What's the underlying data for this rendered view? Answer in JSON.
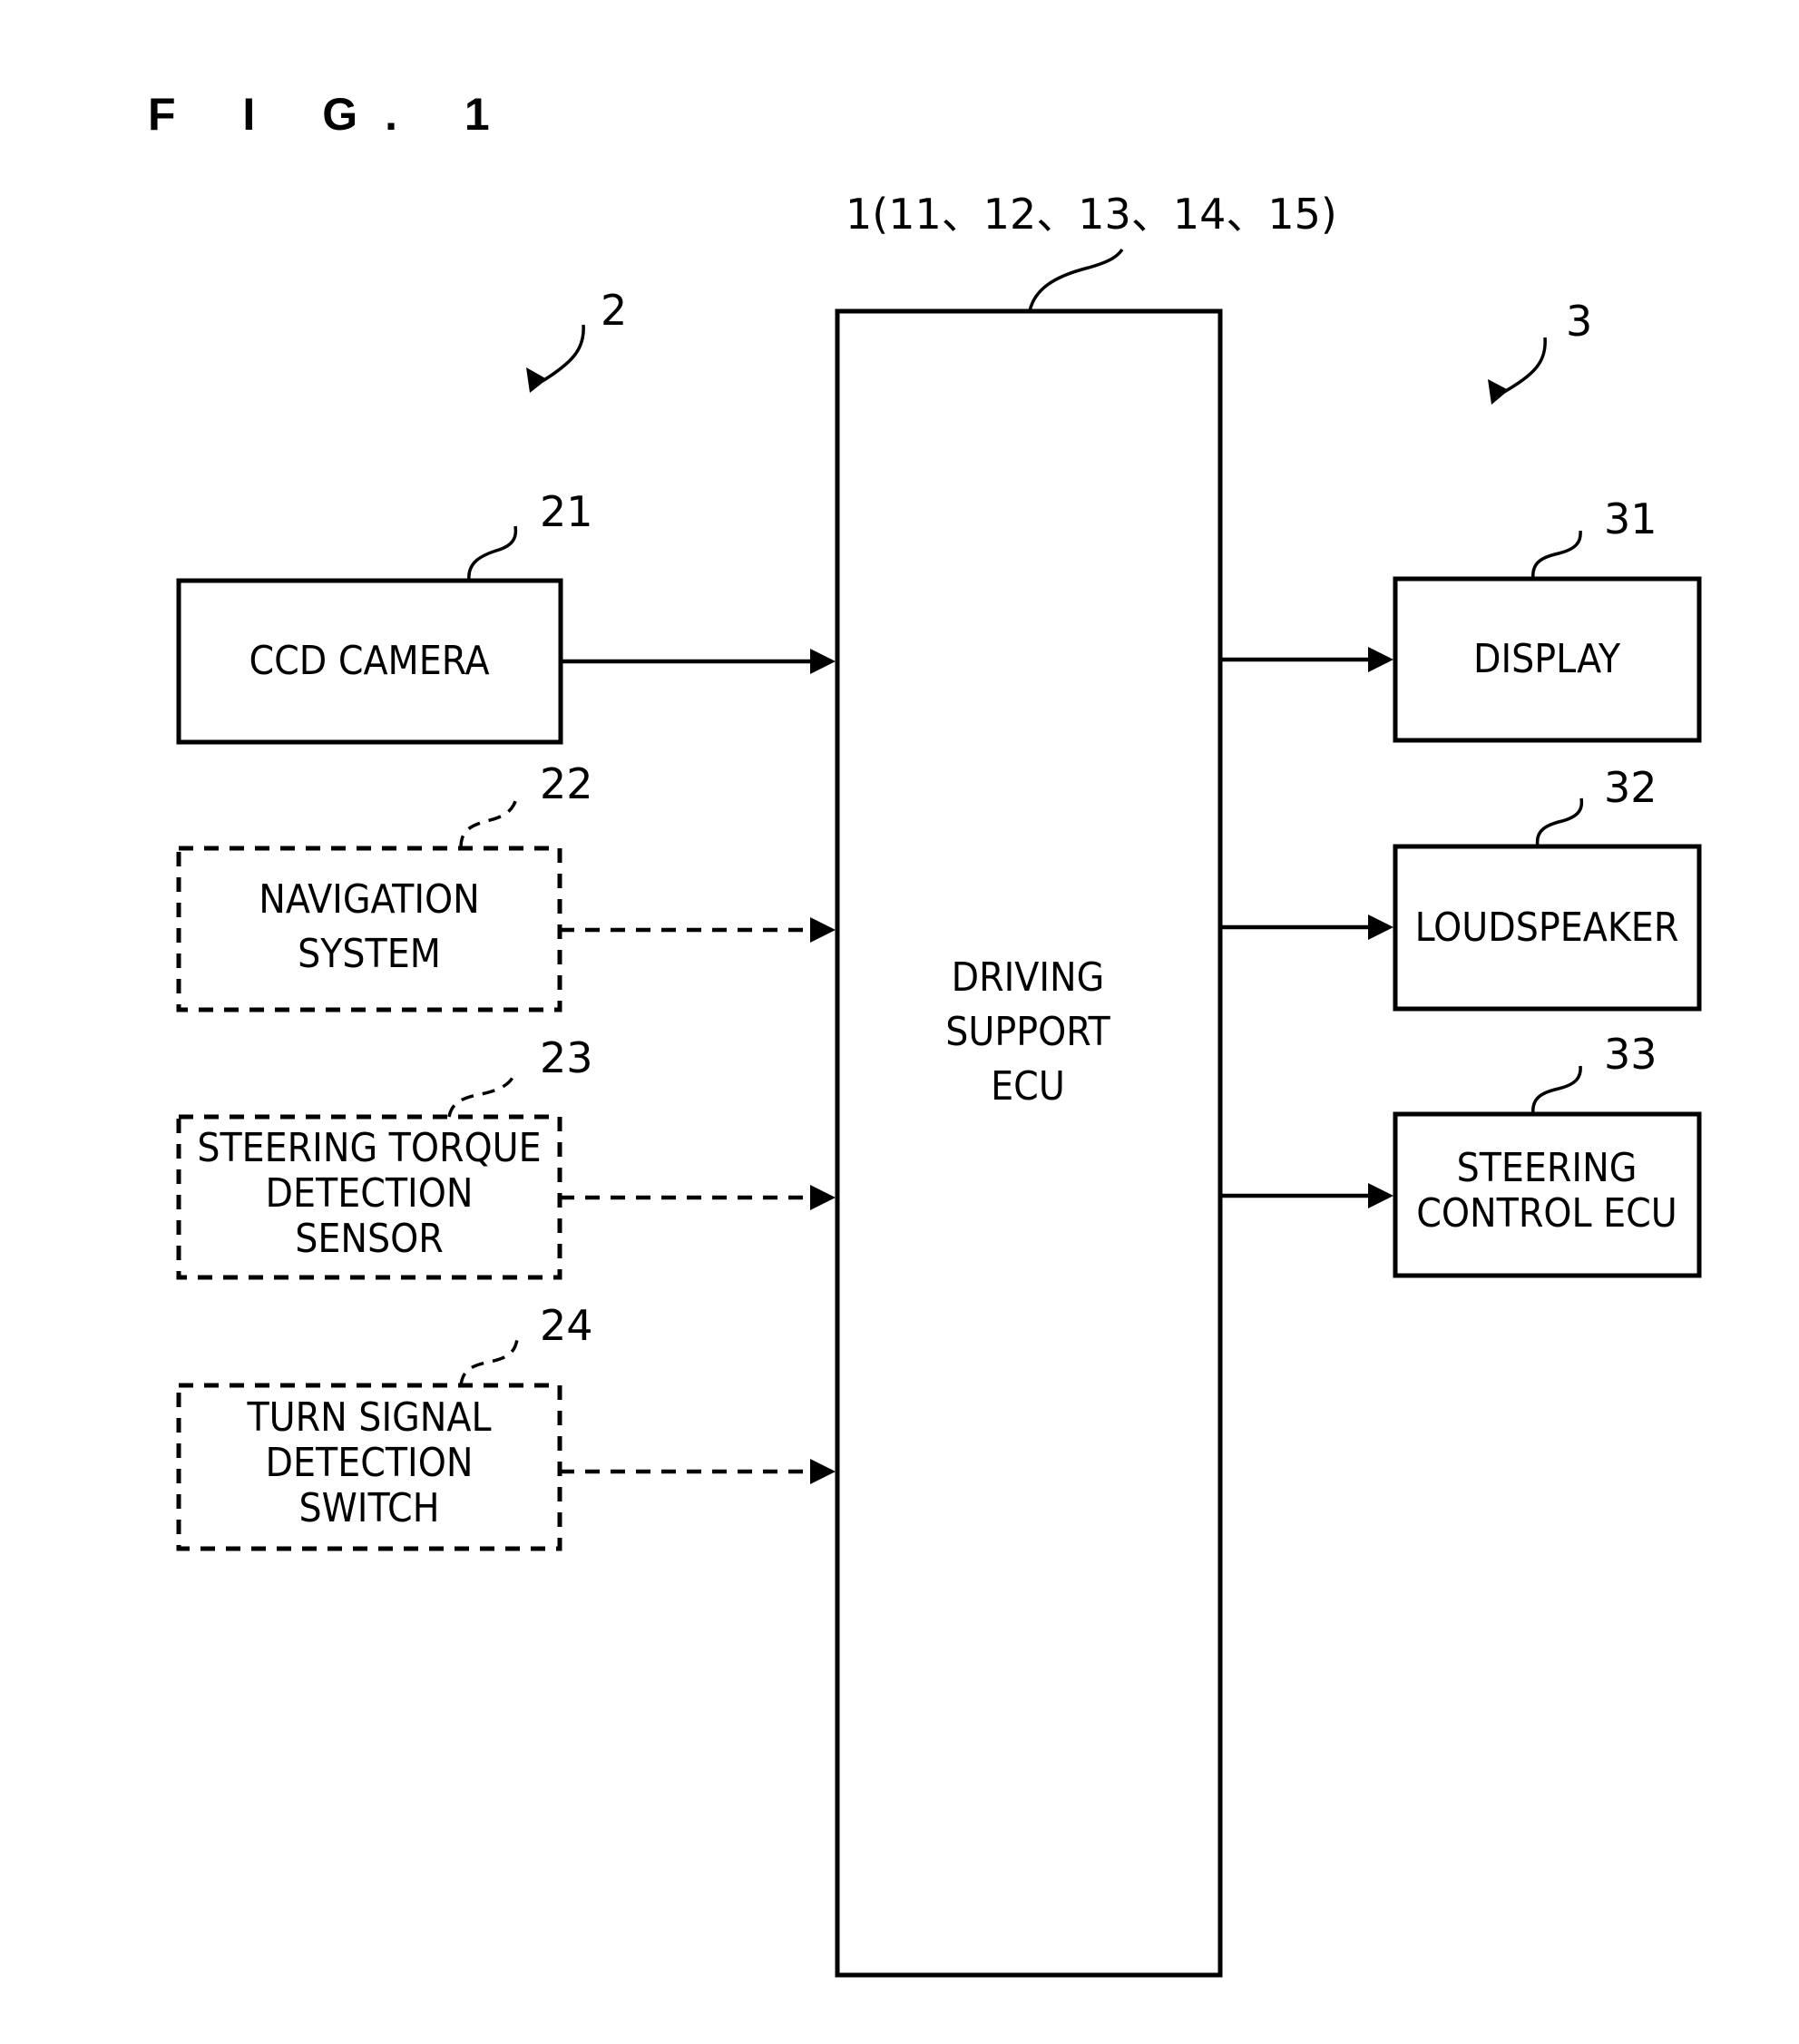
{
  "figure": {
    "title": "F I G. 1"
  },
  "central": {
    "ref": "1(11、12、13、14、15)",
    "lines": [
      "DRIVING",
      "SUPPORT",
      "ECU"
    ]
  },
  "input_group": {
    "ref": "2",
    "items": [
      {
        "ref": "21",
        "lines": [
          "CCD CAMERA"
        ],
        "style": "solid"
      },
      {
        "ref": "22",
        "lines": [
          "NAVIGATION",
          "SYSTEM"
        ],
        "style": "dashed"
      },
      {
        "ref": "23",
        "lines": [
          "STEERING TORQUE",
          "DETECTION",
          "SENSOR"
        ],
        "style": "dashed"
      },
      {
        "ref": "24",
        "lines": [
          "TURN SIGNAL",
          "DETECTION",
          "SWITCH"
        ],
        "style": "dashed"
      }
    ]
  },
  "output_group": {
    "ref": "3",
    "items": [
      {
        "ref": "31",
        "lines": [
          "DISPLAY"
        ],
        "style": "solid"
      },
      {
        "ref": "32",
        "lines": [
          "LOUDSPEAKER"
        ],
        "style": "solid"
      },
      {
        "ref": "33",
        "lines": [
          "STEERING",
          "CONTROL ECU"
        ],
        "style": "solid"
      }
    ]
  }
}
